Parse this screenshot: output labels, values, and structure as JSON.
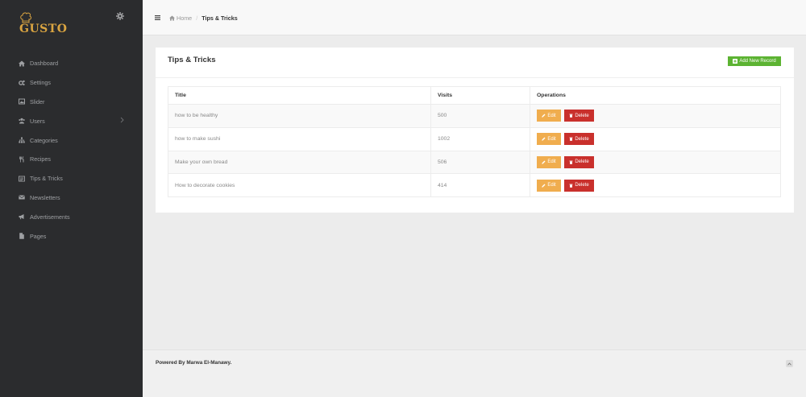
{
  "brand": {
    "logo_text": "GUSTO",
    "accent": "#d9a441"
  },
  "sidebar": {
    "items": [
      {
        "label": "Dashboard",
        "icon": "home-icon"
      },
      {
        "label": "Settings",
        "icon": "cogs-icon"
      },
      {
        "label": "Slider",
        "icon": "image-icon"
      },
      {
        "label": "Users",
        "icon": "users-icon"
      },
      {
        "label": "Categories",
        "icon": "sitemap-icon"
      },
      {
        "label": "Recipes",
        "icon": "cutlery-icon"
      },
      {
        "label": "Tips & Tricks",
        "icon": "list-icon"
      },
      {
        "label": "Newsletters",
        "icon": "envelope-icon"
      },
      {
        "label": "Advertisements",
        "icon": "bullhorn-icon"
      },
      {
        "label": "Pages",
        "icon": "file-icon"
      }
    ]
  },
  "breadcrumb": {
    "home": "Home",
    "current": "Tips & Tricks"
  },
  "panel": {
    "title": "Tips & Tricks",
    "add_label": "Add New Record",
    "add_color": "#5cb332"
  },
  "table": {
    "headers": {
      "title": "Title",
      "visits": "Visits",
      "operations": "Operations"
    },
    "edit_label": "Edit",
    "delete_label": "Delete",
    "rows": [
      {
        "title": "how to be healthy",
        "visits": "500"
      },
      {
        "title": "how to make sushi",
        "visits": "1002"
      },
      {
        "title": "Make your own bread",
        "visits": "506"
      },
      {
        "title": "How to decorate cookies",
        "visits": "414"
      }
    ]
  },
  "footer": {
    "text": "Powered By Marwa El-Manawy."
  }
}
